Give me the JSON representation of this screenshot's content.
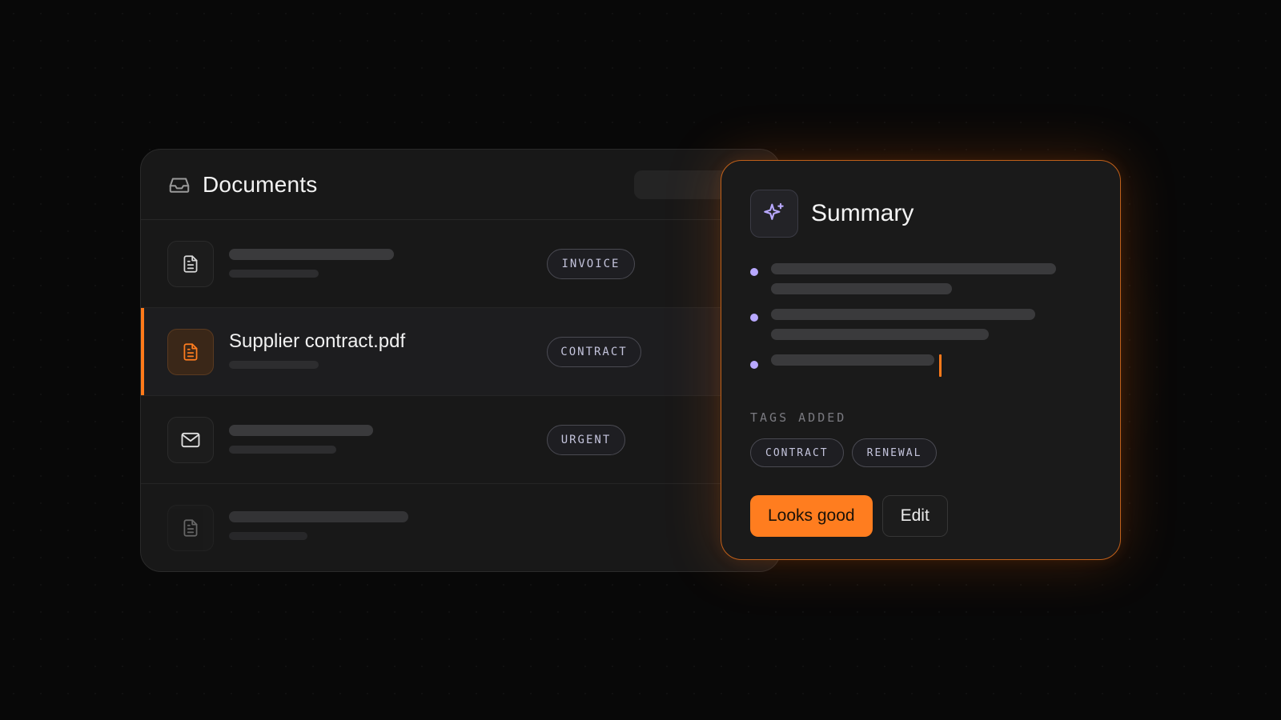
{
  "documents": {
    "title": "Documents",
    "header_icon": "inbox-icon",
    "rows": [
      {
        "icon": "file-text-icon",
        "name": "",
        "tag": "INVOICE"
      },
      {
        "icon": "file-text-icon",
        "name": "Supplier contract.pdf",
        "tag": "CONTRACT",
        "active": true
      },
      {
        "icon": "mail-icon",
        "name": "",
        "tag": "URGENT"
      },
      {
        "icon": "file-text-icon",
        "name": "",
        "tag": ""
      }
    ]
  },
  "summary": {
    "title": "Summary",
    "icon": "sparkle-icon",
    "tags_label": "TAGS ADDED",
    "tags": [
      "CONTRACT",
      "RENEWAL"
    ],
    "primary_button": "Looks good",
    "secondary_button": "Edit"
  },
  "colors": {
    "accent": "#ff7d1f",
    "bullet": "#b8a8ff",
    "background": "#080808",
    "panel": "#181818"
  }
}
